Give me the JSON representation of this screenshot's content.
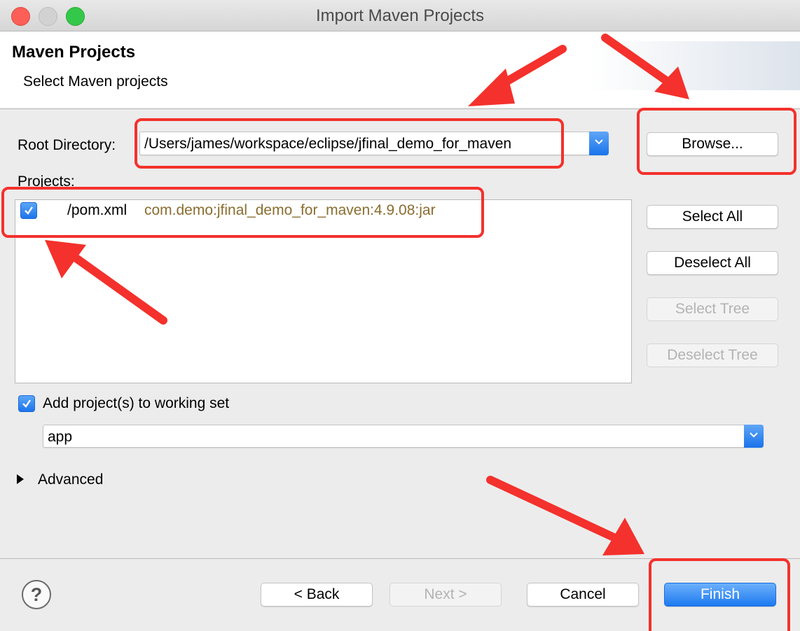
{
  "window": {
    "title": "Import Maven Projects"
  },
  "header": {
    "title": "Maven Projects",
    "subtitle": "Select Maven projects"
  },
  "root_directory": {
    "label": "Root Directory:",
    "value": "/Users/james/workspace/eclipse/jfinal_demo_for_maven",
    "browse_label": "Browse..."
  },
  "projects": {
    "label": "Projects:",
    "items": [
      {
        "checked": true,
        "path": "/pom.xml",
        "coords": "com.demo:jfinal_demo_for_maven:4.9.08:jar"
      }
    ]
  },
  "side_buttons": {
    "select_all": "Select All",
    "deselect_all": "Deselect All",
    "select_tree": "Select Tree",
    "deselect_tree": "Deselect Tree"
  },
  "working_set": {
    "checked": true,
    "label": "Add project(s) to working set",
    "value": "app"
  },
  "advanced": {
    "label": "Advanced"
  },
  "footer": {
    "back": "< Back",
    "next": "Next >",
    "cancel": "Cancel",
    "finish": "Finish"
  },
  "colors": {
    "accent": "#1d7af0",
    "annotation": "#f4312c",
    "coords_text": "#8a6d2f"
  },
  "icons": {
    "help": "help-icon",
    "dropdown": "chevron-down-icon",
    "check": "checkmark-icon",
    "disclosure": "disclosure-triangle-icon"
  }
}
